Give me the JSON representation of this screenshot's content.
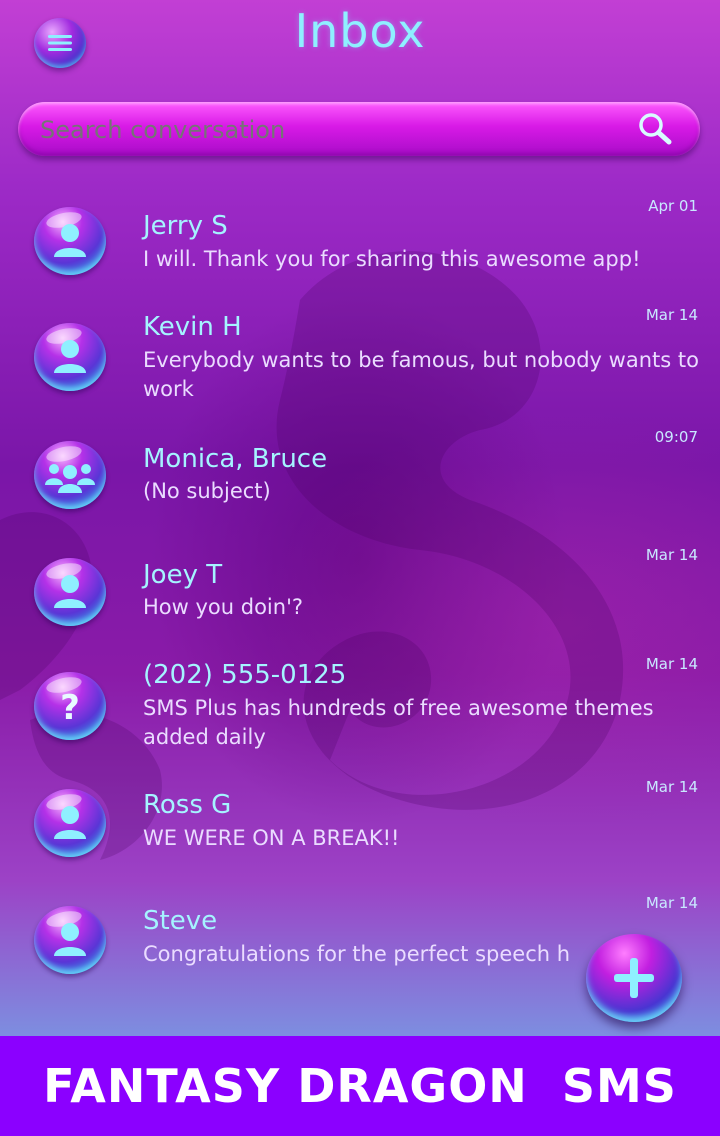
{
  "header": {
    "title": "Inbox",
    "menu_icon": "hamburger-menu-icon"
  },
  "search": {
    "placeholder": "Search conversation",
    "icon": "search-icon"
  },
  "conversations": [
    {
      "name": "Jerry S",
      "snippet": "I will. Thank you for sharing this awesome app!",
      "date": "Apr 01",
      "avatar": "contact-icon"
    },
    {
      "name": "Kevin H",
      "snippet": "Everybody wants to be famous, but nobody wants to work",
      "date": "Mar 14",
      "avatar": "contact-icon"
    },
    {
      "name": "Monica, Bruce",
      "snippet": "(No subject)",
      "date": "09:07",
      "avatar": "group-icon"
    },
    {
      "name": "Joey T",
      "snippet": "How you doin'?",
      "date": "Mar 14",
      "avatar": "contact-icon"
    },
    {
      "name": "(202) 555-0125",
      "snippet": "SMS Plus has hundreds of free awesome themes added daily",
      "date": "Mar 14",
      "avatar": "unknown-contact-icon"
    },
    {
      "name": "Ross G",
      "snippet": "WE WERE ON A BREAK!!",
      "date": "Mar 14",
      "avatar": "contact-icon"
    },
    {
      "name": "Steve",
      "snippet": "Congratulations for the perfect speech h",
      "date": "Mar 14",
      "avatar": "contact-icon"
    }
  ],
  "fab": {
    "icon": "plus-icon"
  },
  "banner": {
    "text": "FANTASY DRAGON  SMS"
  },
  "colors": {
    "accent_cyan": "#8ff0ff",
    "search_bar": "#d81ae6",
    "banner": "#8b00ff"
  }
}
